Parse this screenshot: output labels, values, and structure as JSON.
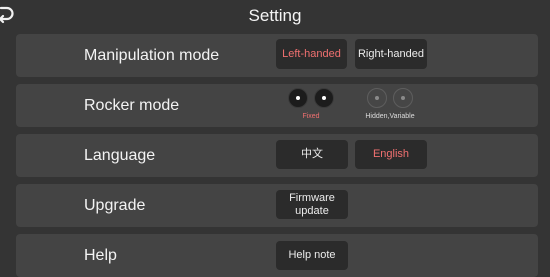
{
  "header": {
    "title": "Setting",
    "back_icon": "back-arrow-icon"
  },
  "manipulation": {
    "label": "Manipulation mode",
    "left_handed": "Left-handed",
    "right_handed": "Right-handed",
    "selected": "Left-handed"
  },
  "rocker": {
    "label": "Rocker mode",
    "fixed_caption": "Fixed",
    "hidden_caption": "Hidden,Variable",
    "selected": "Fixed"
  },
  "language": {
    "label": "Language",
    "chinese": "中文",
    "english": "English",
    "selected": "English"
  },
  "upgrade": {
    "label": "Upgrade",
    "firmware_update": "Firmware update"
  },
  "help": {
    "label": "Help",
    "help_note": "Help note"
  },
  "colors": {
    "background": "#343434",
    "row": "#444444",
    "button": "#2b2b2b",
    "accent": "#f07070",
    "text": "#f0f0f0"
  }
}
